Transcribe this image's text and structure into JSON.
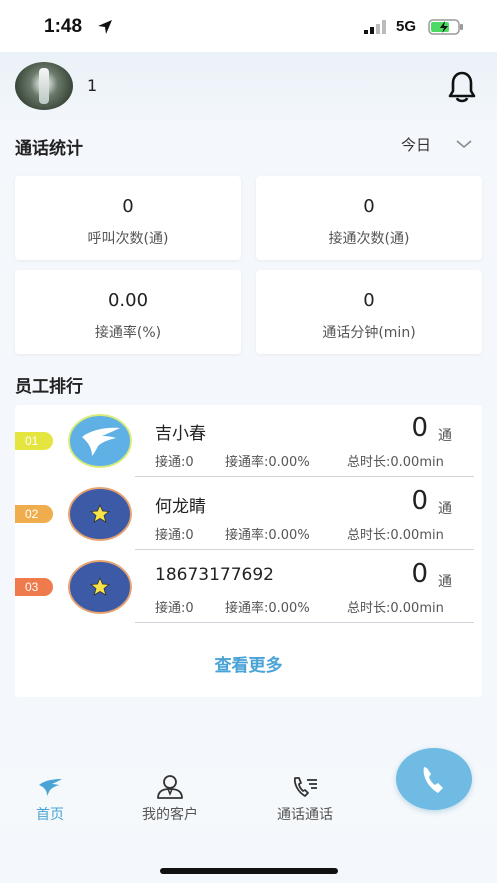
{
  "status_bar": {
    "time": "1:48",
    "network": "5G"
  },
  "header": {
    "user_name": "1"
  },
  "call_stats": {
    "title": "通话统计",
    "period": "今日",
    "cards": [
      {
        "value": "0",
        "label": "呼叫次数(通)"
      },
      {
        "value": "0",
        "label": "接通次数(通)"
      },
      {
        "value": "0.00",
        "label": "接通率(%)"
      },
      {
        "value": "0",
        "label": "通话分钟(min)"
      }
    ]
  },
  "ranking": {
    "title": "员工排行",
    "rows": [
      {
        "rank": "01",
        "name": "吉小春",
        "count": "0",
        "unit": "通",
        "connected": "接通:0",
        "rate": "接通率:0.00%",
        "duration": "总时长:0.00min"
      },
      {
        "rank": "02",
        "name": "何龙睛",
        "count": "0",
        "unit": "通",
        "connected": "接通:0",
        "rate": "接通率:0.00%",
        "duration": "总时长:0.00min"
      },
      {
        "rank": "03",
        "name": "18673177692",
        "count": "0",
        "unit": "通",
        "connected": "接通:0",
        "rate": "接通率:0.00%",
        "duration": "总时长:0.00min"
      }
    ],
    "more_label": "查看更多"
  },
  "tabbar": {
    "tabs": [
      {
        "label": "首页",
        "icon": "home-bird-icon"
      },
      {
        "label": "我的客户",
        "icon": "customer-icon"
      },
      {
        "label": "通话通话",
        "icon": "call-list-icon"
      }
    ]
  },
  "colors": {
    "accent": "#4aa3d6",
    "rank1": "#e4e53f",
    "rank2": "#f0ad4e",
    "rank3": "#ef7a4b",
    "fab": "#6fbbe3"
  }
}
